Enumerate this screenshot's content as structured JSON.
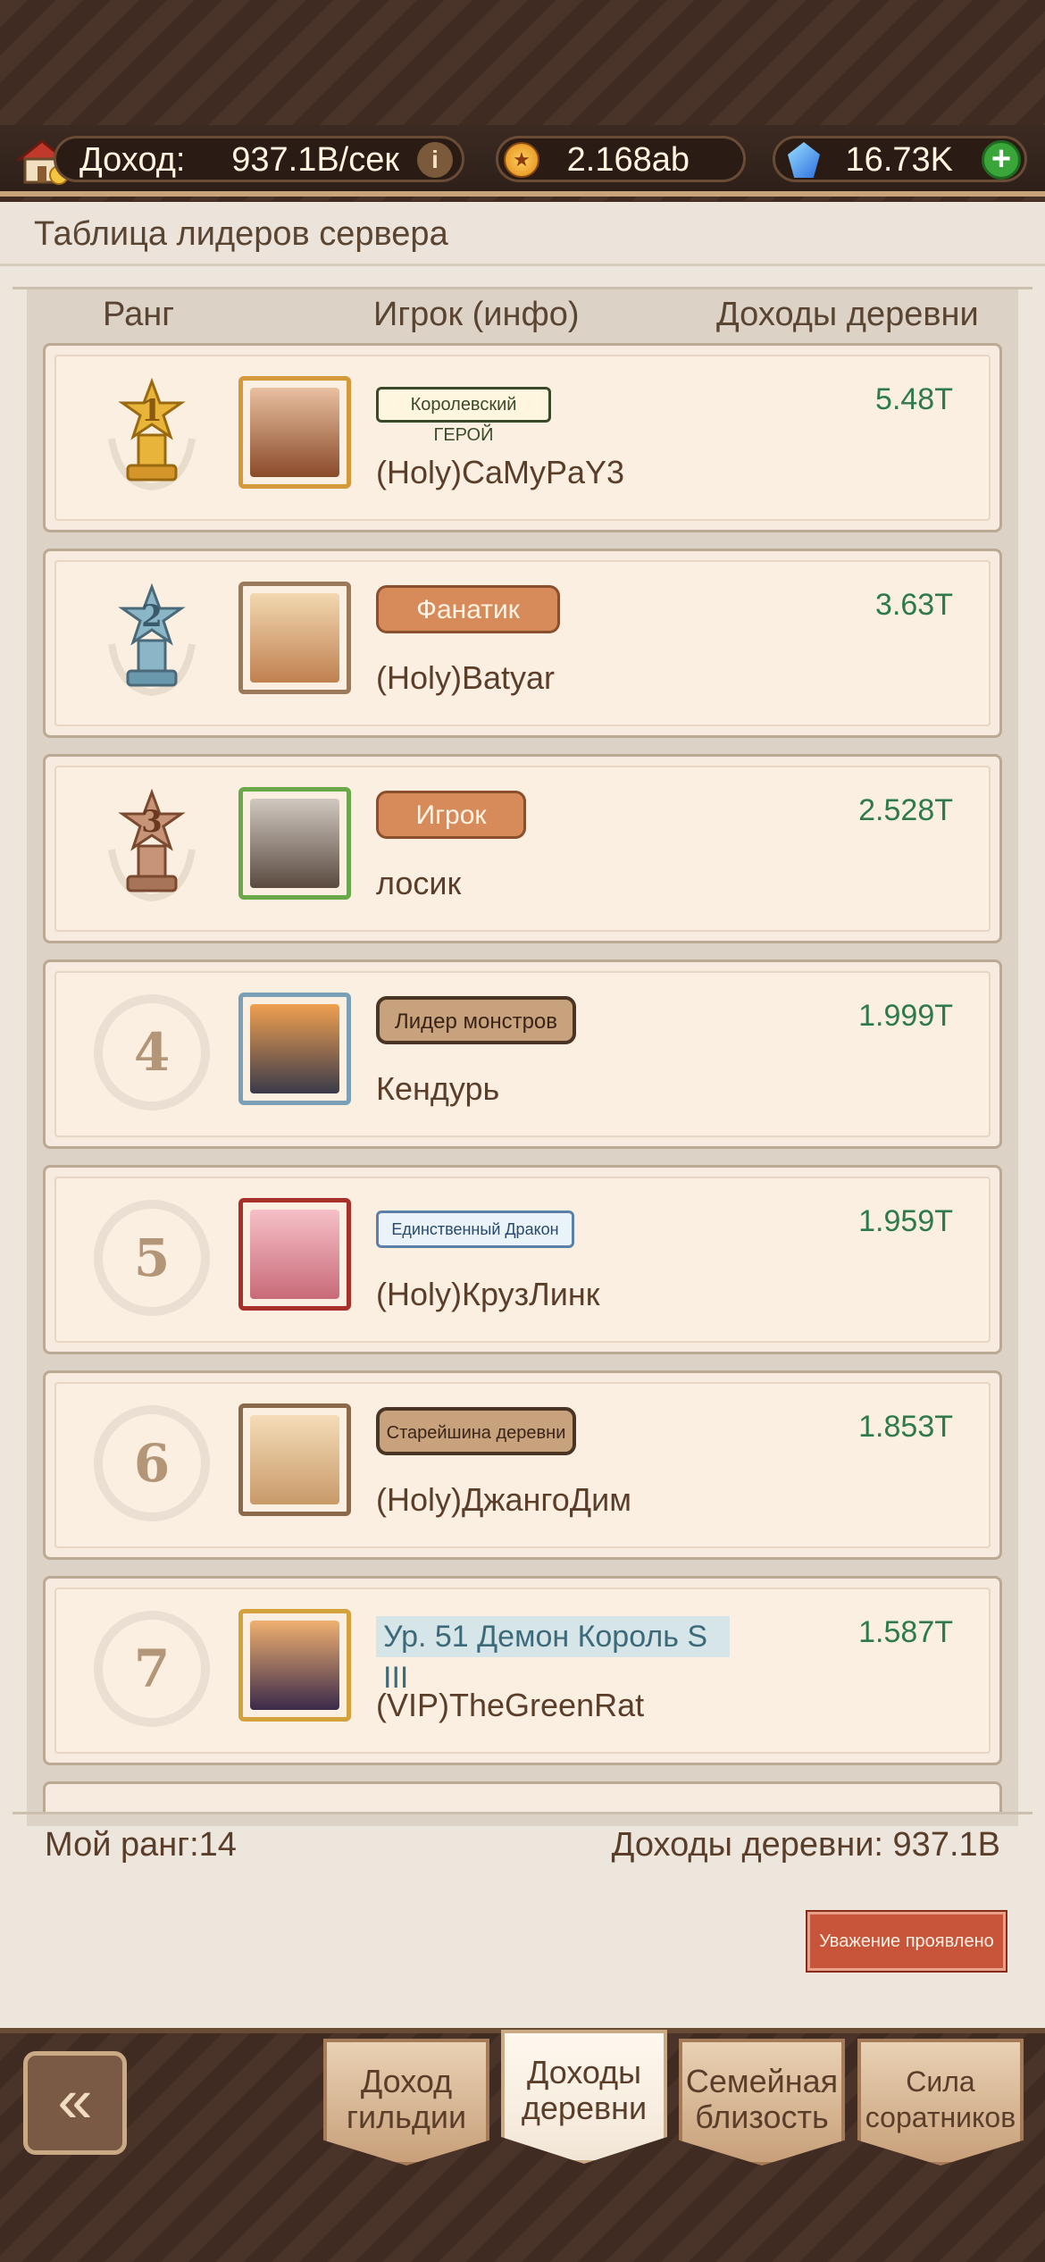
{
  "header": {
    "income_label": "Доход:",
    "income_value": "937.1B/сек",
    "coins_value": "2.168ab",
    "gems_value": "16.73K"
  },
  "panel": {
    "title": "Таблица лидеров сервера",
    "columns": {
      "rank": "Ранг",
      "player": "Игрок (инфо)",
      "income": "Доходы деревни"
    }
  },
  "rows": [
    {
      "rank": "1",
      "title": "Королевский ГЕРОЙ",
      "name": "(Holy)CaMyPaY3",
      "income": "5.48T"
    },
    {
      "rank": "2",
      "title": "Фанатик",
      "name": "(Holy)Batyar",
      "income": "3.63T"
    },
    {
      "rank": "3",
      "title": "Игрок",
      "name": "лосик",
      "income": "2.528T"
    },
    {
      "rank": "4",
      "title": "Лидер монстров",
      "name": "Кендурь",
      "income": "1.999T"
    },
    {
      "rank": "5",
      "title": "Единственный Дракон",
      "name": "(Holy)КрузЛинк",
      "income": "1.959T"
    },
    {
      "rank": "6",
      "title": "Старейшина деревни",
      "name": "(Holy)ДжангоДим",
      "income": "1.853T"
    },
    {
      "rank": "7",
      "title": "Ур. 51 Демон Король S III",
      "name": "(VIP)TheGreenRat",
      "income": "1.587T"
    }
  ],
  "footer": {
    "my_rank": "Мой ранг:14",
    "my_income_label": "Доходы деревни:",
    "my_income_value": "937.1B",
    "respect_button": "Уважение проявлено"
  },
  "nav": {
    "back": "«",
    "tabs": [
      "Доход гильдии",
      "Доходы деревни",
      "Семейная близость",
      "Сила соратников"
    ],
    "active_tab": "Доходы деревни"
  },
  "colors": {
    "income_green": "#2e7a4a",
    "gold": "#d4a23a",
    "silver": "#8ab0c0",
    "bronze": "#c08a6a"
  }
}
